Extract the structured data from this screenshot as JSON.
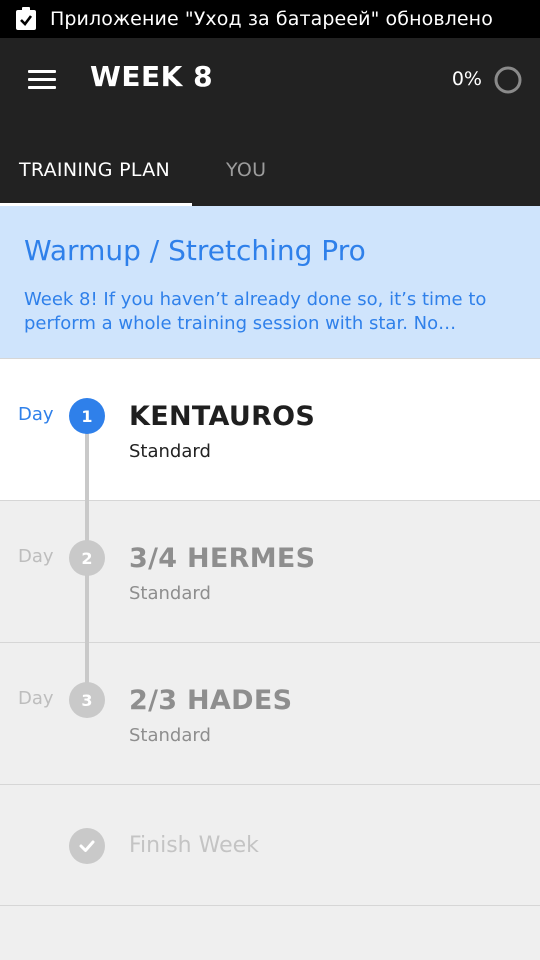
{
  "status_bar": {
    "icon": "clipboard-check-icon",
    "notification": "Приложение \"Уход за батареей\" обновлено"
  },
  "app_bar": {
    "menu_icon": "hamburger-menu-icon",
    "title": "WEEK 8",
    "progress_text": "0%",
    "progress_value": 0
  },
  "tabs": [
    {
      "label": "TRAINING PLAN",
      "active": true
    },
    {
      "label": "YOU",
      "active": false
    }
  ],
  "banner": {
    "title": "Warmup / Stretching Pro",
    "description": "Week 8! If you haven’t already done so, it’s time to perform a whole training session with star. No…"
  },
  "days": [
    {
      "day_label": "Day",
      "number": "1",
      "name": "KENTAUROS",
      "type": "Standard",
      "active": true
    },
    {
      "day_label": "Day",
      "number": "2",
      "name": "3/4 HERMES",
      "type": "Standard",
      "active": false
    },
    {
      "day_label": "Day",
      "number": "3",
      "name": "2/3 HADES",
      "type": "Standard",
      "active": false
    }
  ],
  "finish": {
    "icon": "check-icon",
    "label": "Finish Week"
  },
  "colors": {
    "accent": "#2f80ea",
    "app_bar": "#222222",
    "banner_bg": "#cfe4fc",
    "inactive": "#c9c9c9"
  }
}
